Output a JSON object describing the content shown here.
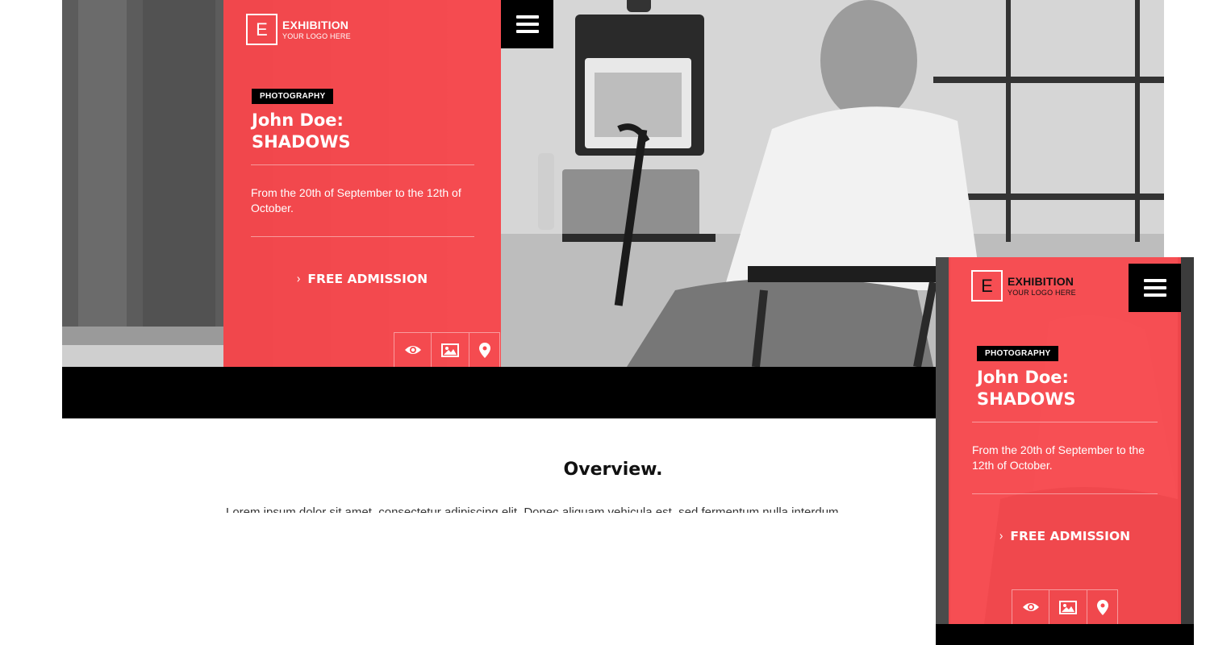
{
  "brand": {
    "logo_letter": "E",
    "title": "EXHIBITION",
    "subtitle": "YOUR LOGO HERE"
  },
  "exhibition": {
    "category": "PHOTOGRAPHY",
    "title_line1": "John Doe:",
    "title_line2": "SHADOWS",
    "dates": "From the 20th of September to the 12th of October.",
    "cta_label": "FREE ADMISSION"
  },
  "icons": [
    "eye-icon",
    "image-icon",
    "map-pin-icon",
    "hamburger-menu-icon"
  ],
  "overview": {
    "title": "Overview.",
    "text": "Lorem ipsum dolor sit amet, consectetur adipiscing elit. Donec aliquam vehicula est, sed fermentum nulla interdum"
  },
  "colors": {
    "accent": "#F8474C",
    "dark": "#000000",
    "text": "#FFFFFF"
  }
}
